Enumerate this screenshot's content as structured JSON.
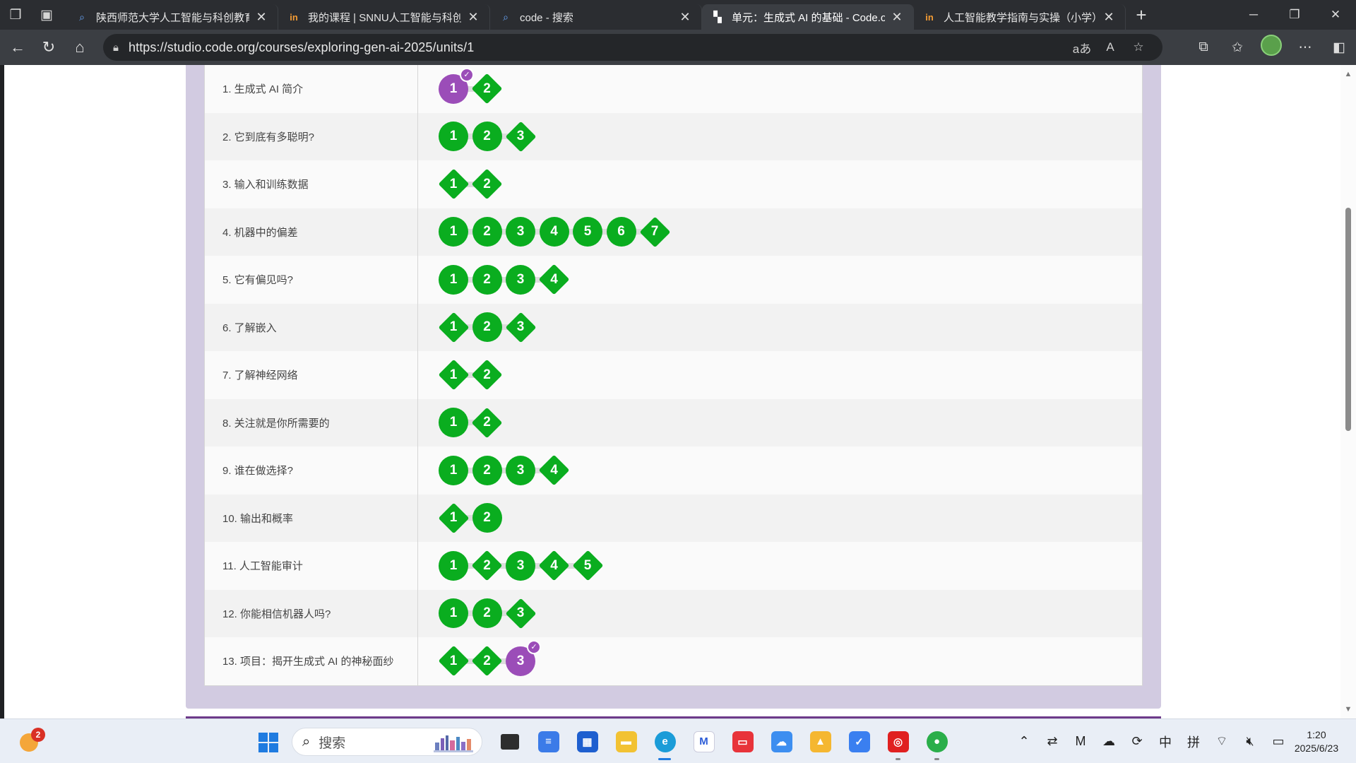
{
  "browser": {
    "tabs": [
      {
        "title": "陕西师范大学人工智能与科创教育",
        "favicon": "search-icon",
        "active": false
      },
      {
        "title": "我的课程 | SNNU人工智能与科创",
        "favicon": "in-logo",
        "active": false
      },
      {
        "title": "code - 搜索",
        "favicon": "search-icon",
        "active": false
      },
      {
        "title": "单元：生成式 AI 的基础 - Code.org",
        "favicon": "code-org-logo",
        "active": true
      },
      {
        "title": "人工智能教学指南与实操（小学）",
        "favicon": "in-logo",
        "active": false
      }
    ],
    "url": "https://studio.code.org/courses/exploring-gen-ai-2025/units/1",
    "translate_label": "aあ",
    "read_aloud_label": "A"
  },
  "lessons": [
    {
      "name": "1. 生成式 AI 简介",
      "bubbles": [
        {
          "n": "1",
          "shape": "circle",
          "purple": true,
          "check": true
        },
        {
          "n": "2",
          "shape": "diamond"
        }
      ]
    },
    {
      "name": "2. 它到底有多聪明?",
      "bubbles": [
        {
          "n": "1",
          "shape": "circle"
        },
        {
          "n": "2",
          "shape": "circle"
        },
        {
          "n": "3",
          "shape": "diamond"
        }
      ]
    },
    {
      "name": "3. 输入和训练数据",
      "bubbles": [
        {
          "n": "1",
          "shape": "diamond"
        },
        {
          "n": "2",
          "shape": "diamond"
        }
      ]
    },
    {
      "name": "4. 机器中的偏差",
      "bubbles": [
        {
          "n": "1",
          "shape": "circle"
        },
        {
          "n": "2",
          "shape": "circle"
        },
        {
          "n": "3",
          "shape": "circle"
        },
        {
          "n": "4",
          "shape": "circle"
        },
        {
          "n": "5",
          "shape": "circle"
        },
        {
          "n": "6",
          "shape": "circle"
        },
        {
          "n": "7",
          "shape": "diamond"
        }
      ]
    },
    {
      "name": "5. 它有偏见吗?",
      "bubbles": [
        {
          "n": "1",
          "shape": "circle"
        },
        {
          "n": "2",
          "shape": "circle"
        },
        {
          "n": "3",
          "shape": "circle"
        },
        {
          "n": "4",
          "shape": "diamond"
        }
      ]
    },
    {
      "name": "6. 了解嵌入",
      "bubbles": [
        {
          "n": "1",
          "shape": "diamond"
        },
        {
          "n": "2",
          "shape": "circle"
        },
        {
          "n": "3",
          "shape": "diamond"
        }
      ]
    },
    {
      "name": "7. 了解神经网络",
      "bubbles": [
        {
          "n": "1",
          "shape": "diamond"
        },
        {
          "n": "2",
          "shape": "diamond"
        }
      ]
    },
    {
      "name": "8. 关注就是你所需要的",
      "bubbles": [
        {
          "n": "1",
          "shape": "circle"
        },
        {
          "n": "2",
          "shape": "diamond"
        }
      ]
    },
    {
      "name": "9. 谁在做选择?",
      "bubbles": [
        {
          "n": "1",
          "shape": "circle"
        },
        {
          "n": "2",
          "shape": "circle"
        },
        {
          "n": "3",
          "shape": "circle"
        },
        {
          "n": "4",
          "shape": "diamond"
        }
      ]
    },
    {
      "name": "10. 输出和概率",
      "bubbles": [
        {
          "n": "1",
          "shape": "diamond"
        },
        {
          "n": "2",
          "shape": "circle"
        }
      ]
    },
    {
      "name": "11. 人工智能审计",
      "bubbles": [
        {
          "n": "1",
          "shape": "circle"
        },
        {
          "n": "2",
          "shape": "diamond"
        },
        {
          "n": "3",
          "shape": "circle"
        },
        {
          "n": "4",
          "shape": "diamond"
        },
        {
          "n": "5",
          "shape": "diamond"
        }
      ]
    },
    {
      "name": "12. 你能相信机器人吗?",
      "bubbles": [
        {
          "n": "1",
          "shape": "circle"
        },
        {
          "n": "2",
          "shape": "circle"
        },
        {
          "n": "3",
          "shape": "diamond"
        }
      ]
    },
    {
      "name": "13. 项目：揭开生成式 AI 的神秘面纱",
      "bubbles": [
        {
          "n": "1",
          "shape": "diamond"
        },
        {
          "n": "2",
          "shape": "diamond"
        },
        {
          "n": "3",
          "shape": "circle",
          "purple": true,
          "check": true
        }
      ]
    }
  ],
  "colors": {
    "complete": "#0aad1f",
    "current": "#9b4db8",
    "panel": "#d2cbe1"
  },
  "taskbar": {
    "weather_badge": "2",
    "search_placeholder": "搜索",
    "tray": {
      "ime_lang": "中",
      "ime_mode": "拼"
    },
    "clock_time": "1:20",
    "clock_date": "2025/6/23"
  }
}
